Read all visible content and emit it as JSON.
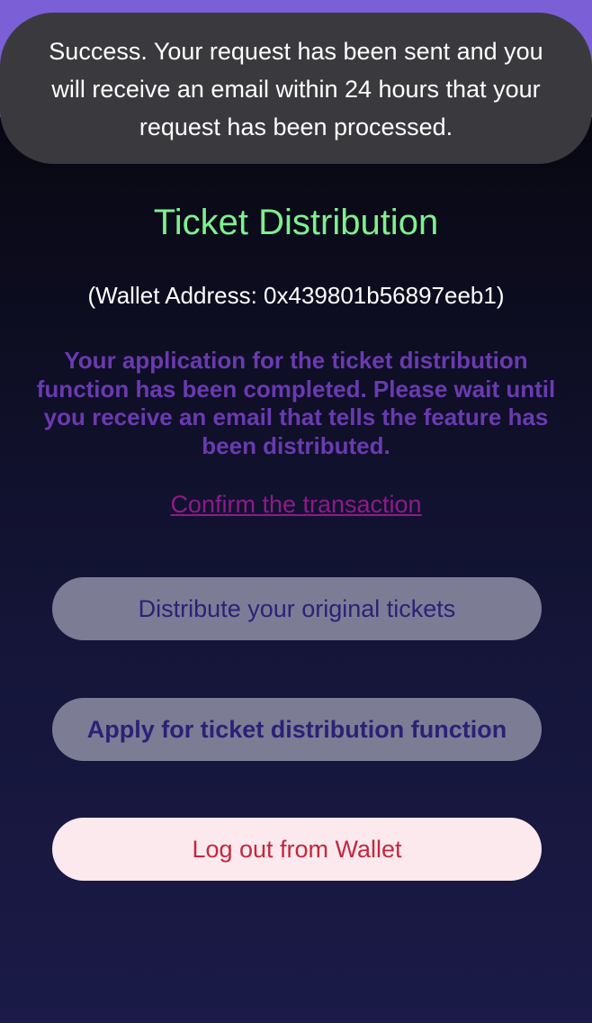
{
  "toast": {
    "message": "Success. Your request has been sent and you will receive an email within 24 hours that your request has been processed."
  },
  "page": {
    "title": "Ticket Distribution",
    "wallet_address": "(Wallet Address: 0x439801b56897eeb1)",
    "notice": "Your application for the ticket distribution function has been completed. Please wait until you receive an email that tells the feature has been distributed.",
    "confirm_link": "Confirm the transaction"
  },
  "buttons": {
    "distribute": "Distribute your original tickets",
    "apply": "Apply for ticket distribution function",
    "logout": "Log out from Wallet"
  },
  "colors": {
    "header": "#7b5fd6",
    "title": "#7ef08f",
    "notice": "#6a3ab0",
    "link": "#8e1a88",
    "logout_text": "#c2283e"
  },
  "icons": {
    "menu": "hamburger-menu-icon"
  }
}
